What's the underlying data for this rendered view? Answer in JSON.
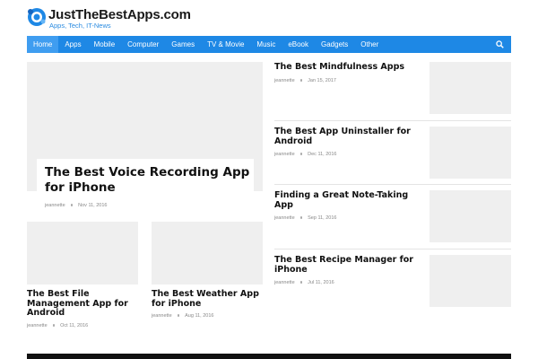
{
  "site": {
    "title": "JustTheBestApps.com",
    "tagline": "Apps, Tech, IT-News"
  },
  "nav": {
    "items": [
      "Home",
      "Apps",
      "Mobile",
      "Computer",
      "Games",
      "TV & Movie",
      "Music",
      "eBook",
      "Gadgets",
      "Other"
    ],
    "active": "Home",
    "search_icon": "search-icon"
  },
  "featured": {
    "title": "The Best Voice Recording App for iPhone",
    "author": "jeannette",
    "date": "Nov 11, 2016"
  },
  "cards": [
    {
      "title": "The Best File Management App for Android",
      "author": "jeannette",
      "date": "Oct 11, 2016"
    },
    {
      "title": "The Best Weather App for iPhone",
      "author": "jeannette",
      "date": "Aug 11, 2016"
    }
  ],
  "sidebar_posts": [
    {
      "title": "The Best Mindfulness Apps",
      "author": "jeannette",
      "date": "Jan 15, 2017"
    },
    {
      "title": "The Best App Uninstaller for Android",
      "author": "jeannette",
      "date": "Dec 11, 2016"
    },
    {
      "title": "Finding a Great Note-Taking App",
      "author": "jeannette",
      "date": "Sep 11, 2016"
    },
    {
      "title": "The Best Recipe Manager for iPhone",
      "author": "jeannette",
      "date": "Jul 11, 2016"
    }
  ],
  "colors": {
    "nav_bg": "#1e88e5",
    "nav_active": "#3f9df0",
    "tagline": "#2a8be0",
    "placeholder": "#efefef"
  }
}
